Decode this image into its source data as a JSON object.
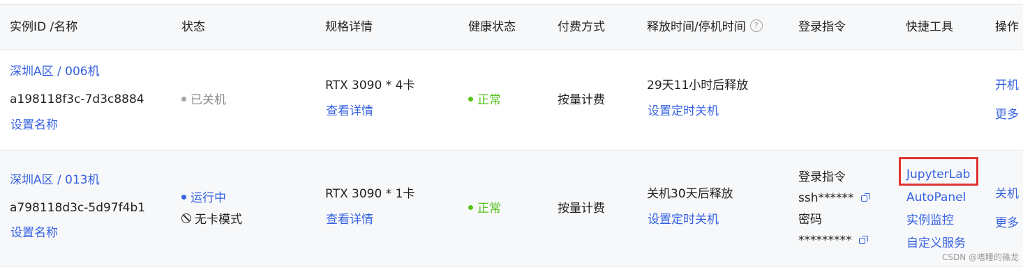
{
  "columns": {
    "id": "实例ID /名称",
    "status": "状态",
    "spec": "规格详情",
    "health": "健康状态",
    "billing": "付费方式",
    "release_time": "释放时间/停机时间",
    "login": "登录指令",
    "tools": "快捷工具",
    "ops": "操作"
  },
  "rows": [
    {
      "region": "深圳A区 / 006机",
      "instance_id": "a198118f3c-7d3c8884",
      "set_name": "设置名称",
      "status": "已关机",
      "spec": "RTX 3090 * 4卡",
      "spec_detail": "查看详情",
      "health": "正常",
      "billing": "按量计费",
      "release": "29天11小时后释放",
      "set_shutdown": "设置定时关机",
      "ops_primary": "开机",
      "ops_more": "更多"
    },
    {
      "region": "深圳A区 / 013机",
      "instance_id": "a798118d3c-5d97f4b1",
      "set_name": "设置名称",
      "status": "运行中",
      "mode": "无卡模式",
      "spec": "RTX 3090 * 1卡",
      "spec_detail": "查看详情",
      "health": "正常",
      "billing": "按量计费",
      "release": "关机30天后释放",
      "set_shutdown": "设置定时关机",
      "login_label": "登录指令",
      "login_value": "ssh******",
      "password_label": "密码",
      "password_value": "*********",
      "tools": [
        "JupyterLab",
        "AutoPanel",
        "实例监控",
        "自定义服务"
      ],
      "ops_primary": "关机",
      "ops_more": "更多"
    }
  ],
  "watermark": "CSDN @嗜睡的篠龙",
  "colors": {
    "link": "#3461e0",
    "ok": "#52c41a",
    "highlight": "#e03131"
  }
}
